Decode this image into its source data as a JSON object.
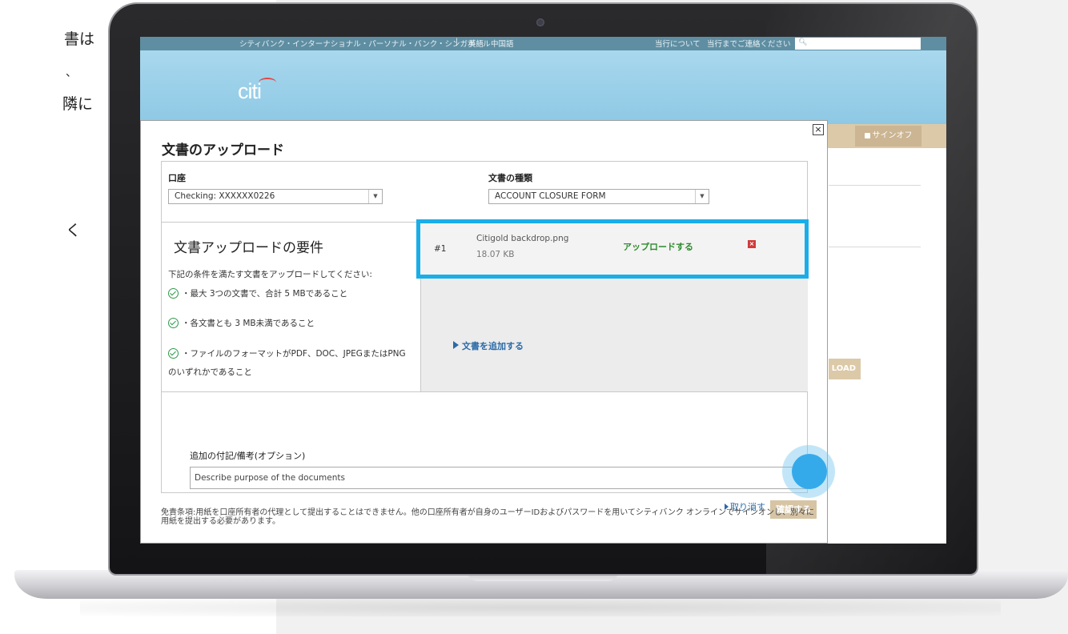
{
  "left_text": [
    "書は",
    "、",
    "隣に",
    "く"
  ],
  "topbar": {
    "site": "シティバンク・インターナショナル・パーソナル・バンク・シンガポール",
    "separator": "|",
    "lang_en": "英語",
    "lang_cn": "中国語",
    "about": "当行について",
    "contact": "当行までご連絡ください"
  },
  "banner": {
    "logo": "citi"
  },
  "navbar": {
    "signoff": "サインオフ"
  },
  "background": {
    "upload_btn": "LOAD"
  },
  "modal": {
    "title": "文書のアップロード",
    "close": "×",
    "account_label": "口座",
    "account_value": "Checking: XXXXXX0226",
    "doctype_label": "文書の種類",
    "doctype_value": "ACCOUNT CLOSURE FORM",
    "requirements": {
      "title": "文書アップロードの要件",
      "intro": "下記の条件を満たす文書をアップロードしてください:",
      "items": [
        "・最大 3つの文書で、合計 5 MBであること",
        "・各文書とも 3 MB未満であること",
        "・ファイルのフォーマットがPDF、DOC、JPEGまたはPNG"
      ],
      "continuation": "のいずれかであること"
    },
    "file": {
      "number": "#1",
      "name": "Citigold backdrop.png",
      "size": "18.07 KB",
      "upload": "アップロードする",
      "delete": "×"
    },
    "add_document": "文書を追加する",
    "notes_label": "追加の付記/備考(オプション)",
    "notes_placeholder": "Describe purpose of the documents",
    "cancel": "取り消す",
    "confirm": "確認する",
    "disclaimer": "免責条項:用紙を口座所有者の代理として提出することはできません。他の口座所有者が自身のユーザーIDおよびパスワードを用いてシティバンク オンラインでサインオンし、別々に用紙を提出する必要があります。"
  }
}
